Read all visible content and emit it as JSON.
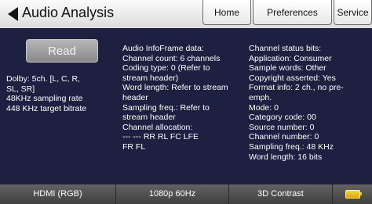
{
  "header": {
    "title": "Audio Analysis",
    "tabs": {
      "home": "Home",
      "preferences": "Preferences",
      "service": "Service"
    }
  },
  "main": {
    "read_label": "Read",
    "summary": [
      "Dolby: 5ch. [L, C, R,",
      "SL, SR]",
      "48KHz sampling rate",
      "448 KHz target bitrate"
    ],
    "infoframe": [
      "Audio InfoFrame data:",
      "Channel count: 6 channels",
      "Coding type: 0 (Refer to",
      "stream header)",
      "Word length: Refer to stream",
      "header",
      "Sampling freq.: Refer to",
      "stream header",
      "Channel allocation:",
      "---  ---  RR  RL  FC  LFE",
      "FR  FL"
    ],
    "channel_status": [
      "Channel status bits:",
      "Application: Consumer",
      "Sample words: Other",
      "Copyright asserted: Yes",
      "Format info: 2 ch., no pre-",
      "emph.",
      "Mode: 0",
      "Category code: 00",
      "Source number: 0",
      "Channel number: 0",
      "Sampling freq.: 48 KHz",
      "Word length: 16 bits"
    ]
  },
  "footer": {
    "interface": "HDMI (RGB)",
    "format": "1080p 60Hz",
    "image": "3D Contrast",
    "battery_icon": "battery-icon"
  },
  "colors": {
    "background": "#1d2040",
    "header": "#e8e8e8",
    "footer": "#505050",
    "battery": "#f0c020"
  }
}
